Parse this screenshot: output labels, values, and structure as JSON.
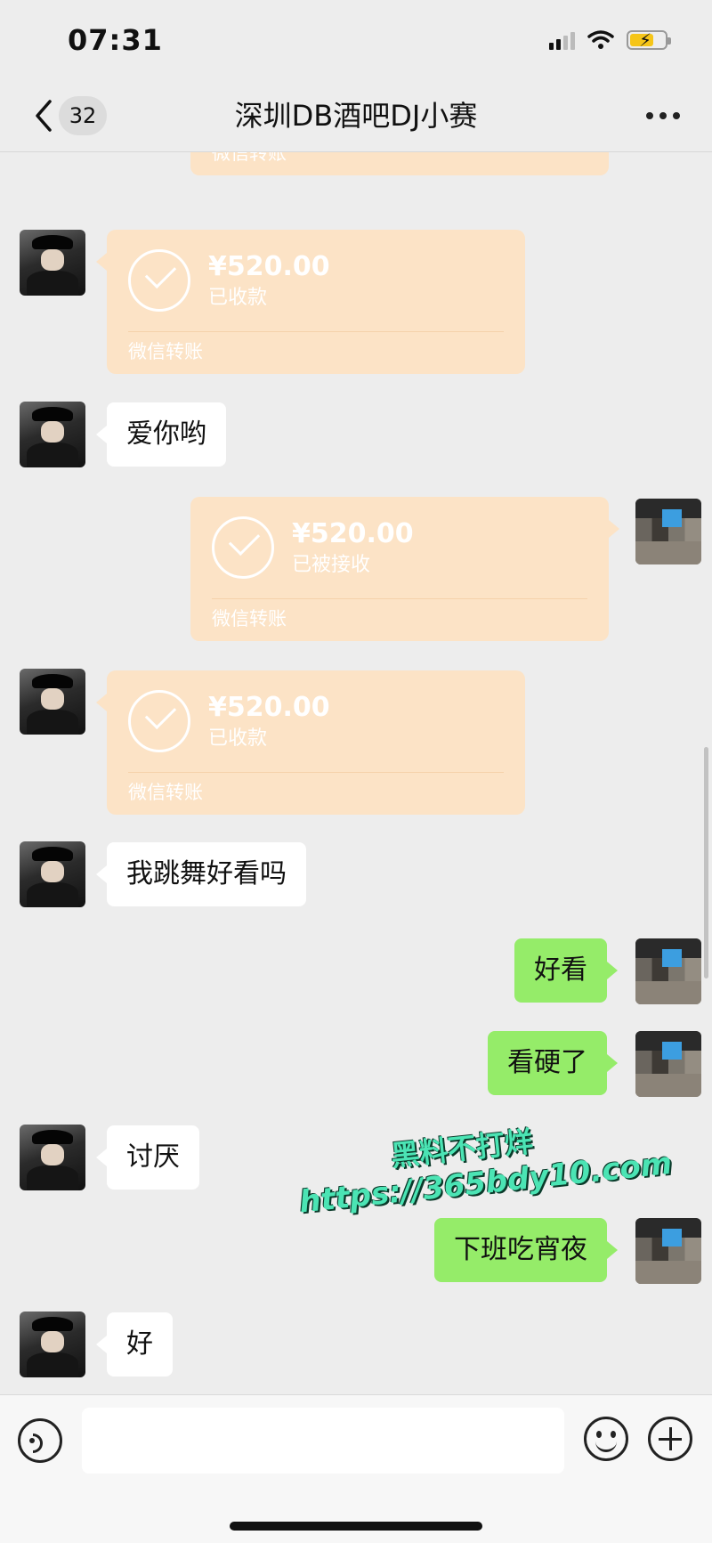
{
  "status_bar": {
    "time": "07:31"
  },
  "nav": {
    "unread_count": "32",
    "title": "深圳DB酒吧DJ小赛"
  },
  "messages": {
    "m0": {
      "footer": "微信转账"
    },
    "m1": {
      "amount": "¥520.00",
      "status": "已收款",
      "footer": "微信转账"
    },
    "m2": {
      "text": "爱你哟"
    },
    "m3": {
      "amount": "¥520.00",
      "status": "已被接收",
      "footer": "微信转账"
    },
    "m4": {
      "amount": "¥520.00",
      "status": "已收款",
      "footer": "微信转账"
    },
    "m5": {
      "text": "我跳舞好看吗"
    },
    "m6": {
      "text": "好看"
    },
    "m7": {
      "text": "看硬了"
    },
    "m8": {
      "text": "讨厌"
    },
    "m9": {
      "text": "下班吃宵夜"
    },
    "m10": {
      "text": "好"
    }
  },
  "watermark": {
    "line1": "黑料不打烊",
    "line2": "https://365bdy10.com"
  },
  "colors": {
    "background": "#ededed",
    "bubble_self": "#95ec69",
    "bubble_other": "#ffffff",
    "transfer": "#fce3c6"
  }
}
